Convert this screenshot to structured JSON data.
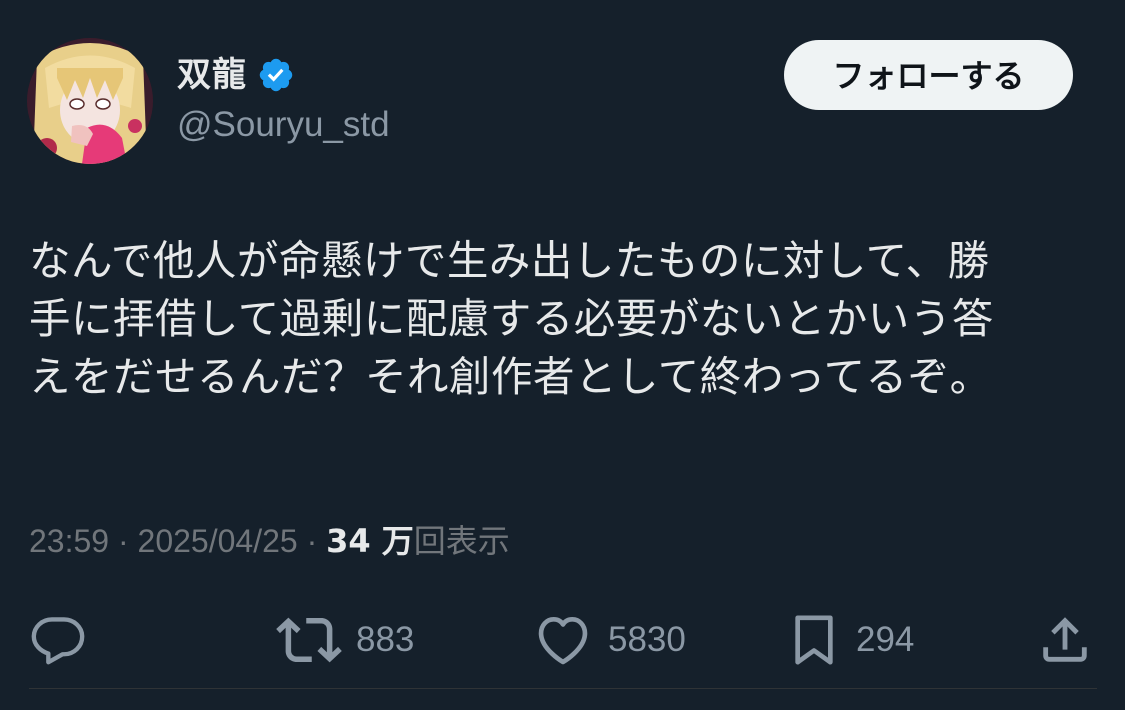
{
  "author": {
    "display_name": "双龍",
    "handle": "@Souryu_std",
    "verified": true,
    "avatar_icon": "avatar-image"
  },
  "follow_button": {
    "label": "フォローする"
  },
  "tweet": {
    "lines": [
      "なんで他人が命懸けで生み出したものに対して、勝",
      "手に拝借して過剰に配慮する必要がないとかいう答",
      "えをだせるんだ？それ創作者として終わってるぞ。"
    ]
  },
  "meta": {
    "time": "23:59",
    "separator": " · ",
    "date": "2025/04/25",
    "views_count": "34 万",
    "views_label": "回表示"
  },
  "actions": {
    "reply": {
      "icon": "reply-icon",
      "count": ""
    },
    "retweet": {
      "icon": "retweet-icon",
      "count": "883"
    },
    "like": {
      "icon": "heart-icon",
      "count": "5830"
    },
    "bookmark": {
      "icon": "bookmark-icon",
      "count": "294"
    },
    "share": {
      "icon": "share-icon",
      "count": ""
    }
  },
  "colors": {
    "background": "#15202b",
    "verified_badge": "#1d9bf0",
    "secondary_text": "#8b98a5",
    "follow_button_bg": "#eff3f4"
  }
}
